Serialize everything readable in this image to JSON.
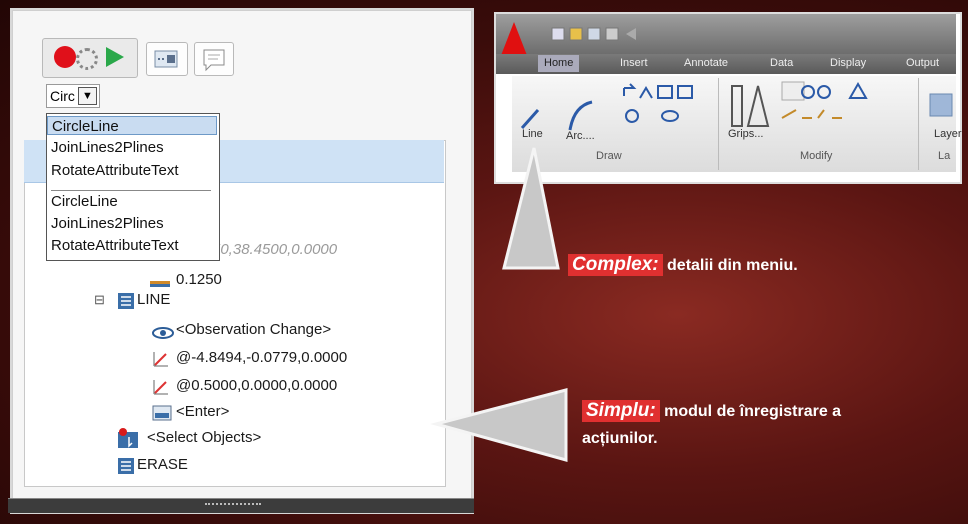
{
  "toolbar": {
    "play_icon": "record-play-icon",
    "btn2_icon": "macro-icon",
    "btn3_icon": "comment-icon"
  },
  "combo": {
    "value": "Circ"
  },
  "dropdown": {
    "items": [
      "CircleLine",
      "JoinLines2Plines",
      "RotateAttributeText",
      "CircleLine",
      "JoinLines2Plines",
      "RotateAttributeText"
    ],
    "selected": 0
  },
  "tree": {
    "faded_point": "50,38.4500,0.0000",
    "radius": "0.1250",
    "line_cmd": "LINE",
    "observation": "<Observation Change>",
    "point1": "@-4.8494,-0.0779,0.0000",
    "point2": "@0.5000,0.0000,0.0000",
    "enter": "<Enter>",
    "select": "<Select Objects>",
    "erase": "ERASE",
    "collapse_symbol": "⊟"
  },
  "ribbon": {
    "tabs": [
      "Home",
      "Insert",
      "Annotate",
      "Data",
      "Display",
      "Output"
    ],
    "panels": [
      "Draw",
      "Modify",
      "La"
    ],
    "buttons": {
      "line": "Line",
      "arc": "Arc....",
      "grips": "Grips...",
      "layer": "Layer"
    }
  },
  "callouts": {
    "complex_tag": "Complex:",
    "complex_text": "detalii din meniu.",
    "simple_tag": "Simplu:",
    "simple_text_1": "modul de înregistrare a",
    "simple_text_2": "acțiunilor."
  },
  "colors": {
    "accent": "#e03030",
    "background": "#5a1512",
    "selection": "#c9dcf1"
  }
}
